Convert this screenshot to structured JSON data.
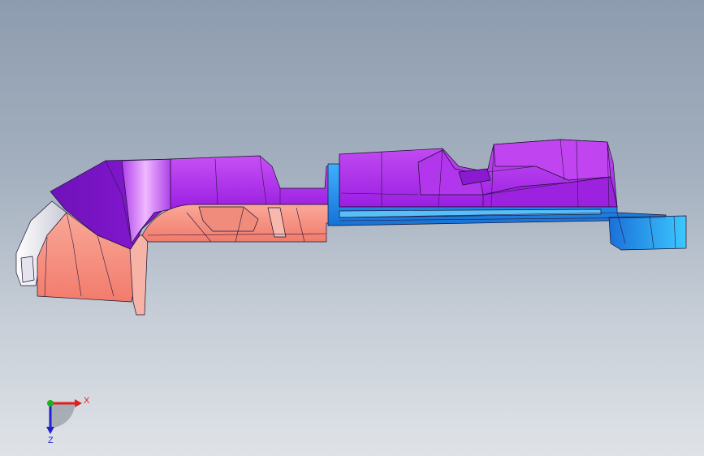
{
  "viewport": {
    "background_top": "#8d9caf",
    "background_bottom": "#dfe3e8"
  },
  "model": {
    "part_colors": {
      "purple": "#a020e0",
      "salmon": "#f4897a",
      "blue": "#1e96f0",
      "white": "#f2f2f7"
    }
  },
  "triad": {
    "x_label": "X",
    "z_label": "Z",
    "x_color": "#e02020",
    "y_color": "#20b020",
    "z_color": "#2020d0",
    "icon": "coordinate-triad-icon"
  }
}
